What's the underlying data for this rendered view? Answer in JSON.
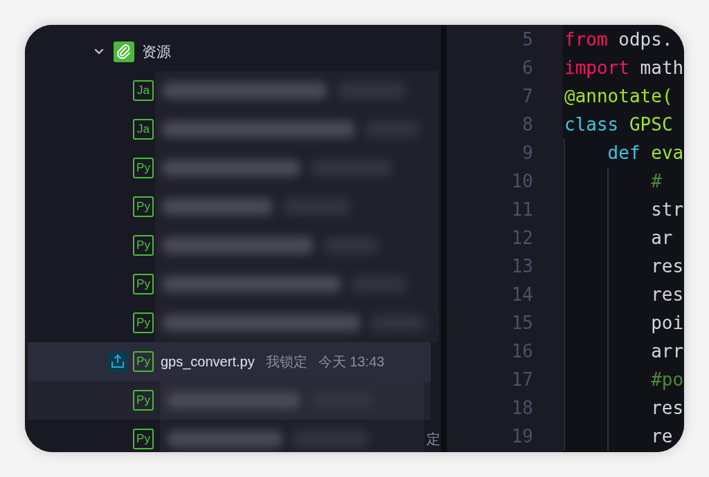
{
  "tree": {
    "label": "资源",
    "expanded": true,
    "items": [
      {
        "kind": "redacted",
        "badge": "Ja",
        "selected": false,
        "hovered": false,
        "uploaded": false
      },
      {
        "kind": "redacted",
        "badge": "Ja",
        "selected": false,
        "hovered": false,
        "uploaded": false
      },
      {
        "kind": "redacted",
        "badge": "Py",
        "selected": false,
        "hovered": false,
        "uploaded": false
      },
      {
        "kind": "redacted",
        "badge": "Py",
        "selected": false,
        "hovered": false,
        "uploaded": false
      },
      {
        "kind": "redacted",
        "badge": "Py",
        "selected": false,
        "hovered": false,
        "uploaded": false
      },
      {
        "kind": "redacted",
        "badge": "Py",
        "selected": false,
        "hovered": false,
        "uploaded": false
      },
      {
        "kind": "redacted",
        "badge": "Py",
        "selected": false,
        "hovered": false,
        "uploaded": false
      },
      {
        "kind": "file",
        "badge": "Py",
        "name": "gps_convert.py",
        "lock": "我锁定",
        "time": "今天 13:43",
        "selected": true,
        "hovered": false,
        "uploaded": true
      },
      {
        "kind": "redacted",
        "badge": "Py",
        "selected": false,
        "hovered": true,
        "uploaded": false
      },
      {
        "kind": "redacted",
        "badge": "Py",
        "tail": "定",
        "selected": false,
        "hovered": false,
        "uploaded": false
      }
    ]
  },
  "editor": {
    "lines": [
      {
        "number": "5",
        "tokens": [
          {
            "kind": "keyword",
            "text": "from"
          },
          {
            "kind": "plain",
            "text": "odps."
          }
        ]
      },
      {
        "number": "6",
        "tokens": [
          {
            "kind": "keyword",
            "text": "import"
          },
          {
            "kind": "plain",
            "text": "math"
          }
        ]
      },
      {
        "number": "7",
        "tokens": [
          {
            "kind": "decorator",
            "text": "@annotate("
          }
        ]
      },
      {
        "number": "8",
        "tokens": [
          {
            "kind": "storage",
            "text": "class"
          },
          {
            "kind": "name",
            "text": "GPSC"
          }
        ],
        "children": [
          {
            "number": "9",
            "tokens": [
              {
                "kind": "storage",
                "text": "def"
              },
              {
                "kind": "name",
                "text": "eva"
              }
            ],
            "children": [
              {
                "number": "10",
                "tokens": [
                  {
                    "kind": "comment",
                    "text": "#"
                  }
                ]
              },
              {
                "number": "11",
                "tokens": [
                  {
                    "kind": "plain",
                    "text": "str"
                  }
                ]
              },
              {
                "number": "12",
                "tokens": [
                  {
                    "kind": "plain",
                    "text": "ar"
                  }
                ]
              },
              {
                "number": "13",
                "tokens": [
                  {
                    "kind": "plain",
                    "text": "res"
                  }
                ]
              },
              {
                "number": "14",
                "tokens": [
                  {
                    "kind": "plain",
                    "text": "res"
                  }
                ]
              },
              {
                "number": "15",
                "tokens": [
                  {
                    "kind": "plain",
                    "text": "poi"
                  }
                ]
              },
              {
                "number": "16",
                "tokens": [
                  {
                    "kind": "plain",
                    "text": "arr"
                  }
                ]
              },
              {
                "number": "17",
                "tokens": [
                  {
                    "kind": "comment",
                    "text": "#po"
                  }
                ]
              },
              {
                "number": "18",
                "tokens": [
                  {
                    "kind": "plain",
                    "text": "res"
                  }
                ]
              },
              {
                "number": "19",
                "tokens": [
                  {
                    "kind": "plain",
                    "text": "re"
                  }
                ]
              }
            ]
          }
        ]
      }
    ]
  }
}
